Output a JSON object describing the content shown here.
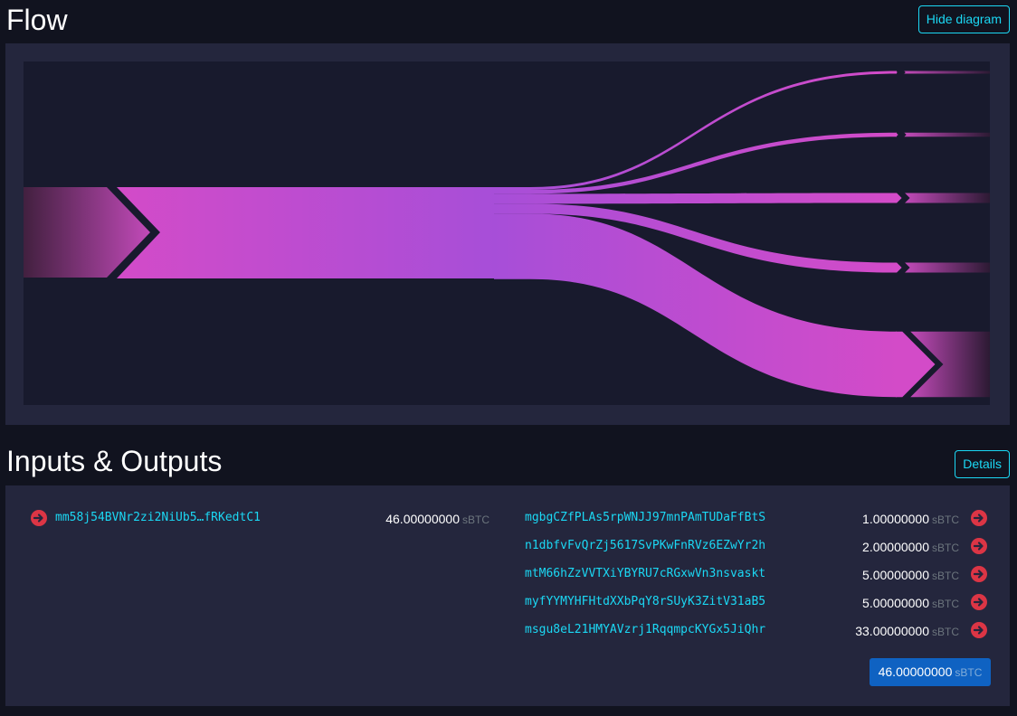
{
  "flow": {
    "title": "Flow",
    "hide_button": "Hide diagram"
  },
  "io": {
    "title": "Inputs & Outputs",
    "details_button": "Details",
    "unit": "sBTC",
    "inputs": [
      {
        "address": "mm58j54BVNr2zi2NiUb5…fRKedtC1",
        "amount": "46.00000000"
      }
    ],
    "outputs": [
      {
        "address": "mgbgCZfPLAs5rpWNJJ97mnPAmTUDaFfBtS",
        "amount": "1.00000000"
      },
      {
        "address": "n1dbfvFvQrZj5617SvPKwFnRVz6EZwYr2h",
        "amount": "2.00000000"
      },
      {
        "address": "mtM66hZzVVTXiYBYRU7cRGxwVn3nsvaskt",
        "amount": "5.00000000"
      },
      {
        "address": "myfYYMYHFHtdXXbPqY8rSUyK3ZitV31aB5",
        "amount": "5.00000000"
      },
      {
        "address": "msgu8eL21HMYAVzrj1RqqmpcKYGx5JiQhr",
        "amount": "33.00000000"
      }
    ],
    "total": "46.00000000"
  },
  "colors": {
    "background": "#11131f",
    "panel": "#24263d",
    "diagram_bg": "#181a2d",
    "accent": "#1bd8f4",
    "flow_pink": "#d34bc8",
    "flow_purple": "#a74ed8",
    "arrow_red": "#dc3545",
    "total_bg": "#0f62c2"
  },
  "icons": {
    "io_arrow": "arrow-circle-right-icon"
  }
}
